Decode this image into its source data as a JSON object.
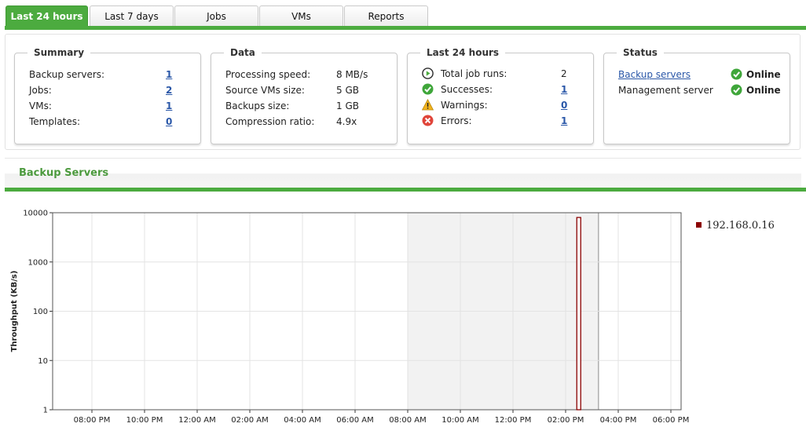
{
  "tabs": [
    {
      "label": "Last 24 hours",
      "active": true
    },
    {
      "label": "Last 7 days",
      "active": false
    },
    {
      "label": "Jobs",
      "active": false
    },
    {
      "label": "VMs",
      "active": false
    },
    {
      "label": "Reports",
      "active": false
    }
  ],
  "summary": {
    "title": "Summary",
    "rows": [
      {
        "label": "Backup servers:",
        "value": "1"
      },
      {
        "label": "Jobs:",
        "value": "2"
      },
      {
        "label": "VMs:",
        "value": "1"
      },
      {
        "label": "Templates:",
        "value": "0"
      }
    ]
  },
  "data_box": {
    "title": "Data",
    "rows": [
      {
        "label": "Processing speed:",
        "value": "8 MB/s"
      },
      {
        "label": "Source VMs size:",
        "value": "5 GB"
      },
      {
        "label": "Backups size:",
        "value": "1 GB"
      },
      {
        "label": "Compression ratio:",
        "value": "4.9x"
      }
    ]
  },
  "last24": {
    "title": "Last 24 hours",
    "rows": [
      {
        "icon": "play-icon",
        "label": "Total job runs:",
        "value": "2"
      },
      {
        "icon": "success-check-icon",
        "label": "Successes:",
        "value": "1"
      },
      {
        "icon": "warning-icon",
        "label": "Warnings:",
        "value": "0"
      },
      {
        "icon": "error-x-icon",
        "label": "Errors:",
        "value": "1"
      }
    ]
  },
  "status": {
    "title": "Status",
    "rows": [
      {
        "label": "Backup servers",
        "value": "Online"
      },
      {
        "label": "Management server",
        "value": "Online"
      }
    ]
  },
  "backup_servers": {
    "title": "Backup Servers"
  },
  "colors": {
    "accent_green": "#4cab3f",
    "link_blue": "#2a57a8",
    "series": "#8b0000",
    "highlight": "#f2f2f2"
  },
  "chart_data": {
    "type": "bar",
    "ylabel": "Throughput (KB/s)",
    "yscale": "log",
    "ylim": [
      1,
      10000
    ],
    "yticks": [
      "10000",
      "1000",
      "100",
      "10",
      "1"
    ],
    "xticks": [
      "08:00 PM",
      "10:00 PM",
      "12:00 AM",
      "02:00 AM",
      "04:00 AM",
      "06:00 AM",
      "08:00 AM",
      "10:00 AM",
      "12:00 PM",
      "02:00 PM",
      "04:00 PM",
      "06:00 PM"
    ],
    "highlighted_range": [
      "08:00 AM",
      "03:15 PM"
    ],
    "series": [
      {
        "name": "192.168.0.16",
        "points": [
          {
            "x": "02:30 PM",
            "y": 8000
          }
        ]
      }
    ],
    "legend": "right",
    "grid": true
  }
}
